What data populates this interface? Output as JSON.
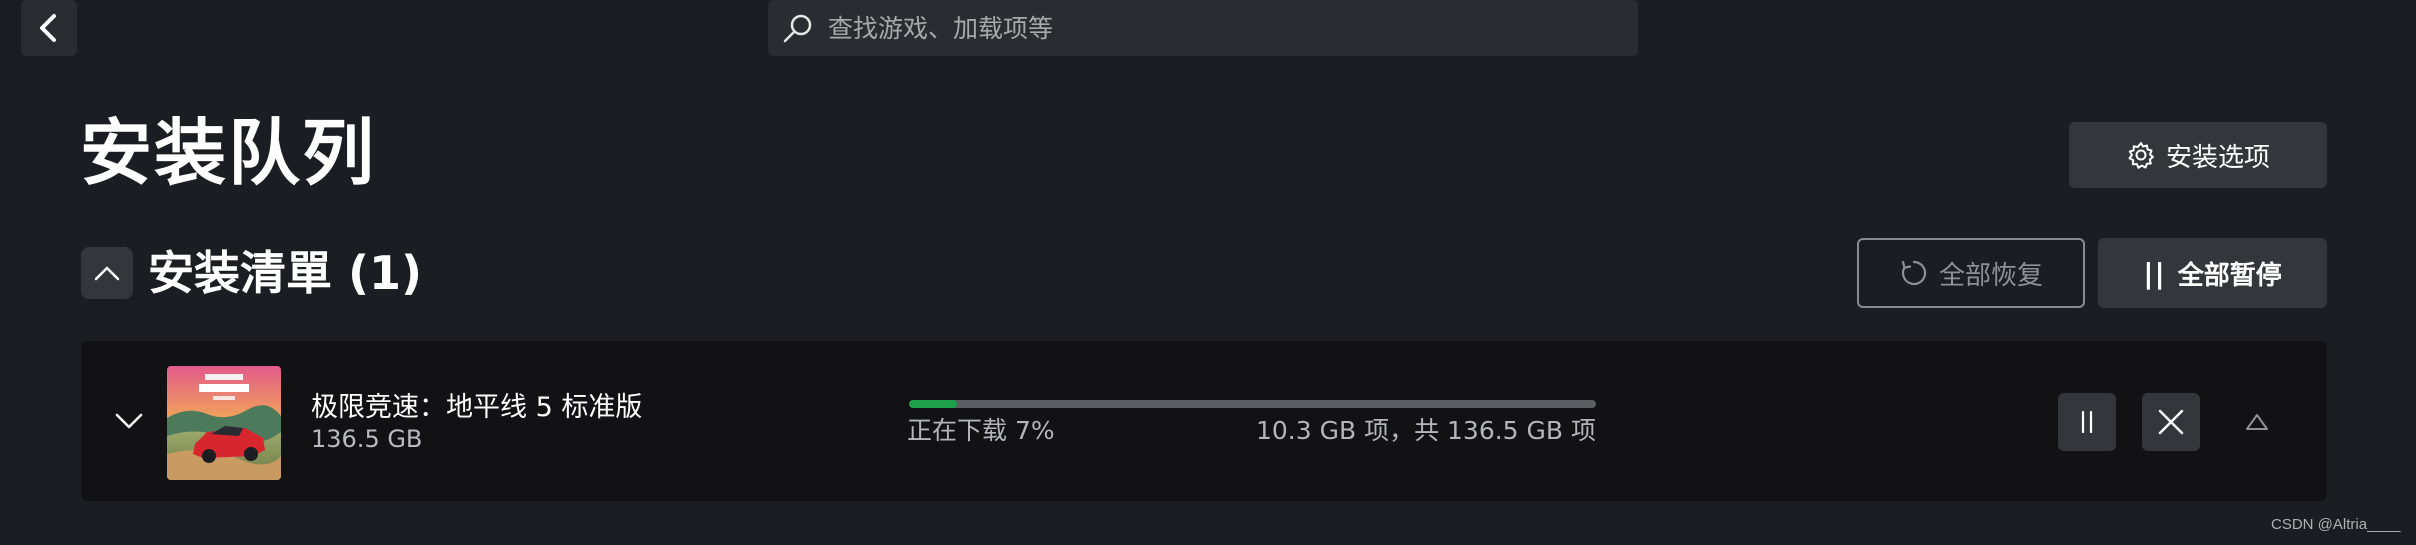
{
  "topbar": {
    "back_icon": "chevron-left-icon",
    "search_placeholder": "查找游戏、加载项等",
    "search_icon": "search-icon"
  },
  "header": {
    "title": "安装队列",
    "install_options_label": "安装选项",
    "install_options_icon": "gear-icon"
  },
  "section": {
    "title": "安装清單 (1)",
    "resume_all_label": "全部恢复",
    "resume_all_icon": "refresh-icon",
    "pause_all_label": "全部暂停",
    "pause_all_icon_text": "||"
  },
  "queue": [
    {
      "title": "极限竞速：地平线 5 标准版",
      "size": "136.5 GB",
      "status": "正在下载 7%",
      "amount": "10.3 GB 项，共 136.5 GB 项",
      "progress_fraction": 0.07
    }
  ],
  "watermark": "CSDN @Altria____",
  "colors": {
    "background": "#1c1d22",
    "card": "#121215",
    "button": "#35363b",
    "progress": "#1fa04a",
    "track": "#5c5d62"
  }
}
